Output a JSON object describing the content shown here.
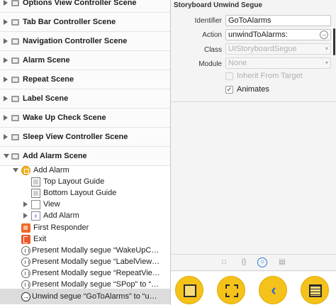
{
  "outline": {
    "scenes": [
      {
        "label": "Options View Controller Scene"
      },
      {
        "label": "Tab Bar Controller Scene"
      },
      {
        "label": "Navigation Controller Scene"
      },
      {
        "label": "Alarm Scene"
      },
      {
        "label": "Repeat Scene"
      },
      {
        "label": "Label Scene"
      },
      {
        "label": "Wake Up Check Scene"
      },
      {
        "label": "Sleep View Controller Scene"
      },
      {
        "label": "Add Alarm Scene"
      }
    ],
    "children": [
      {
        "label": "Add Alarm",
        "icon": "view-controller-icon"
      },
      {
        "label": "Top Layout Guide",
        "icon": "layout-guide-icon"
      },
      {
        "label": "Bottom Layout Guide",
        "icon": "layout-guide-icon"
      },
      {
        "label": "View",
        "icon": "view-icon"
      },
      {
        "label": "Add Alarm",
        "icon": "navigation-item-icon"
      },
      {
        "label": "First Responder",
        "icon": "first-responder-icon"
      },
      {
        "label": "Exit",
        "icon": "exit-icon"
      },
      {
        "label": "Present Modally segue “WakeUpC…",
        "icon": "segue-icon"
      },
      {
        "label": "Present Modally segue “LabelView…",
        "icon": "segue-icon"
      },
      {
        "label": "Present Modally segue “RepeatVie…",
        "icon": "segue-icon"
      },
      {
        "label": "Present Modally segue “SPop” to “…",
        "icon": "segue-icon"
      },
      {
        "label": "Unwind segue “GoToAlarms” to “u…",
        "icon": "unwind-segue-icon"
      }
    ]
  },
  "inspector": {
    "section_title": "Storyboard Unwind Segue",
    "identifier_label": "Identifier",
    "identifier_value": "GoToAlarms",
    "action_label": "Action",
    "action_value": "unwindToAlarms:",
    "class_label": "Class",
    "class_placeholder": "UIStoryboardSegue",
    "module_label": "Module",
    "module_placeholder": "None",
    "inherit_label": "Inherit From Target",
    "animates_label": "Animates",
    "animates_checked": true
  },
  "library": {
    "tabs": [
      "file-icon",
      "braces-icon",
      "object-library-icon",
      "media-icon"
    ],
    "items": [
      "view-controller-icon",
      "storyboard-reference-icon",
      "navigation-controller-icon",
      "table-view-controller-icon"
    ]
  },
  "colors": {
    "accent": "#2a7ee0",
    "library_item": "#f5c21a",
    "selection": "#dcdcdc"
  }
}
